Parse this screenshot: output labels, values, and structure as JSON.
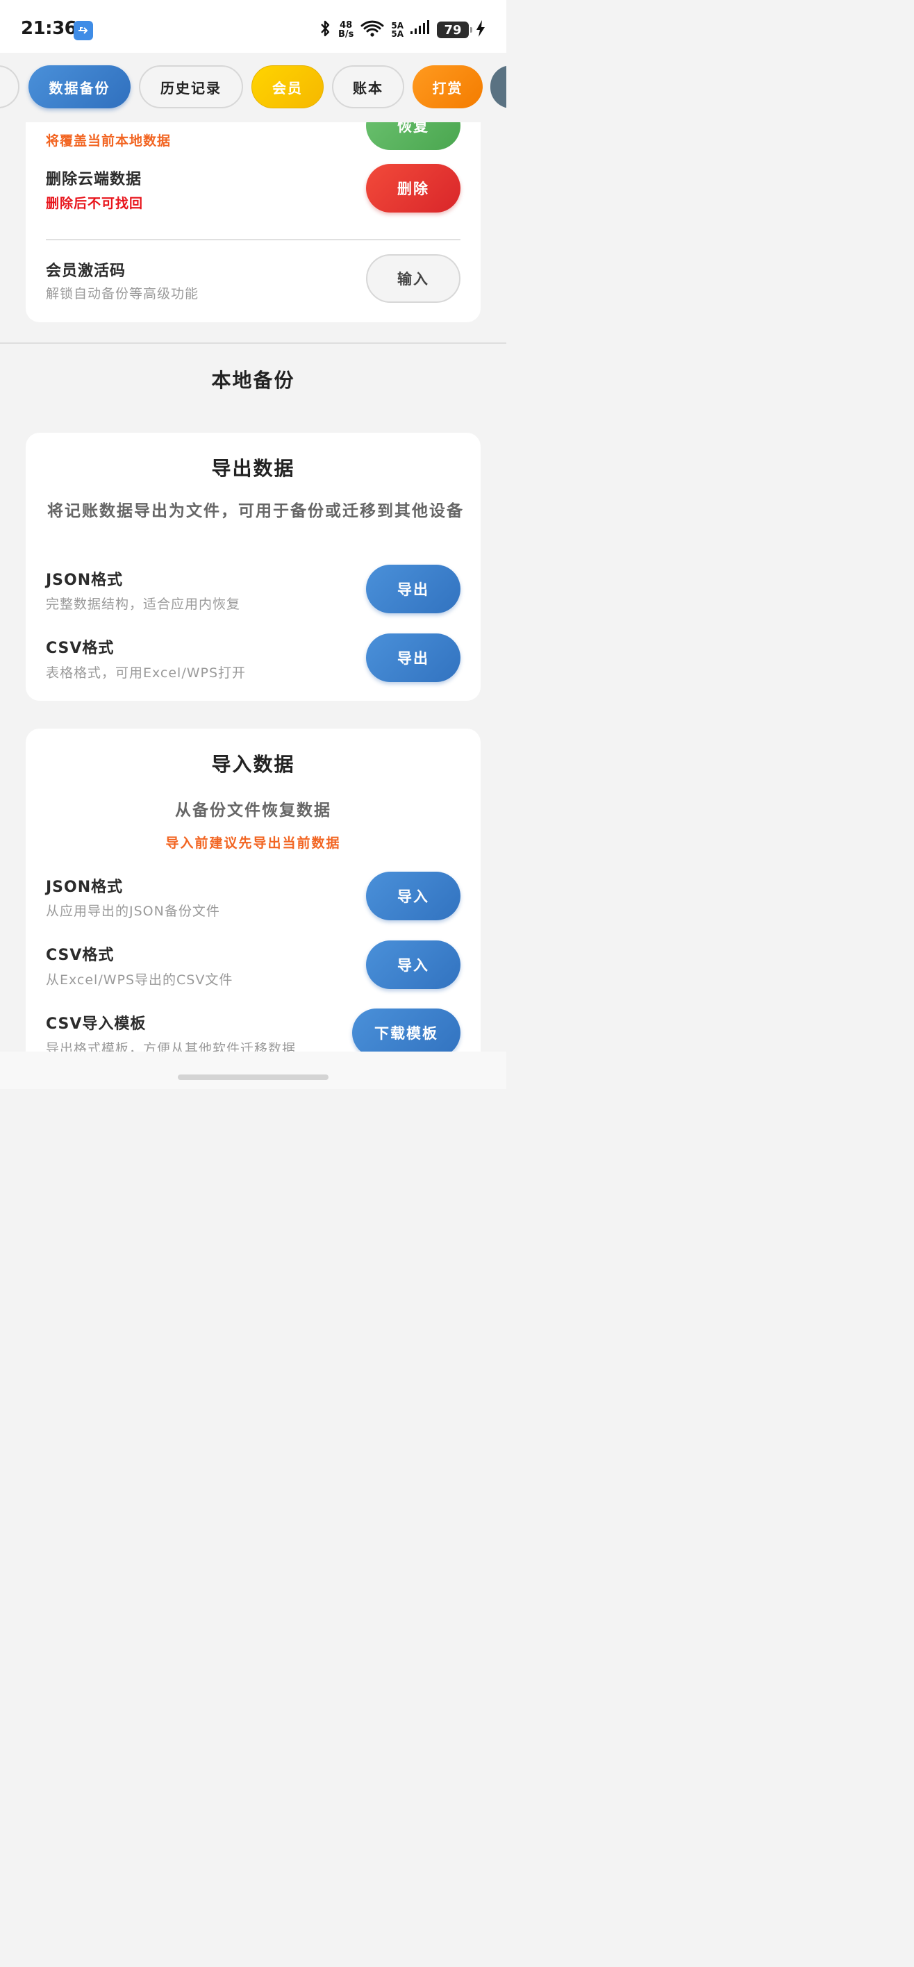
{
  "status_bar": {
    "time": "21:36",
    "net_speed_value": "48",
    "net_speed_unit": "B/s",
    "signal_label_1": "5A",
    "signal_label_2": "5A",
    "battery": "79",
    "icons": [
      "usb-icon",
      "bluetooth-icon",
      "wifi-icon",
      "signal-icon",
      "battery-icon",
      "charging-icon"
    ]
  },
  "tabs": [
    {
      "label": "",
      "state": "partial"
    },
    {
      "label": "数据备份",
      "state": "active"
    },
    {
      "label": "历史记录",
      "state": "normal"
    },
    {
      "label": "会员",
      "state": "gold"
    },
    {
      "label": "账本",
      "state": "normal"
    },
    {
      "label": "打赏",
      "state": "orange"
    },
    {
      "label": "",
      "state": "partial"
    }
  ],
  "cloud": {
    "restore_warning": "将覆盖当前本地数据",
    "restore_button": "恢复",
    "delete_title": "删除云端数据",
    "delete_warning": "删除后不可找回",
    "delete_button": "删除",
    "member_title": "会员激活码",
    "member_sub": "解锁自动备份等高级功能",
    "member_button": "输入"
  },
  "local_backup": {
    "section_title": "本地备份",
    "export": {
      "title": "导出数据",
      "description": "将记账数据导出为文件，可用于备份或迁移到其他设备",
      "json_title": "JSON格式",
      "json_sub": "完整数据结构，适合应用内恢复",
      "json_button": "导出",
      "csv_title": "CSV格式",
      "csv_sub": "表格格式，可用Excel/WPS打开",
      "csv_button": "导出"
    },
    "import": {
      "title": "导入数据",
      "description": "从备份文件恢复数据",
      "warning": "导入前建议先导出当前数据",
      "json_title": "JSON格式",
      "json_sub": "从应用导出的JSON备份文件",
      "json_button": "导入",
      "csv_title": "CSV格式",
      "csv_sub": "从Excel/WPS导出的CSV文件",
      "csv_button": "导入",
      "template_title": "CSV导入模板",
      "template_sub": "导出格式模板，方便从其他软件迁移数据",
      "template_button": "下载模板"
    }
  },
  "colors": {
    "primary_blue": "#3a7fcc",
    "gold": "#ffcc00",
    "orange": "#f47c00",
    "danger_red": "#e8141b",
    "warning_orange": "#f26522",
    "success_green": "#4aa64f"
  }
}
